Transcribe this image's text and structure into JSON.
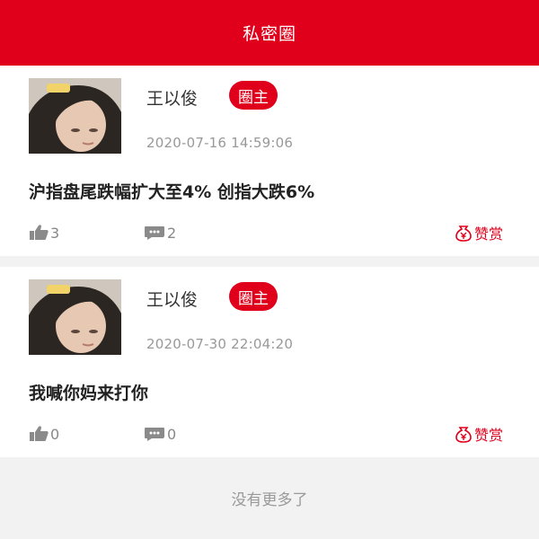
{
  "header": {
    "title": "私密圈"
  },
  "posts": [
    {
      "author": "王以俊",
      "badge": "圈主",
      "timestamp": "2020-07-16 14:59:06",
      "content": "沪指盘尾跌幅扩大至4% 创指大跌6%",
      "likes": "3",
      "comments": "2",
      "reward_label": "赞赏"
    },
    {
      "author": "王以俊",
      "badge": "圈主",
      "timestamp": "2020-07-30 22:04:20",
      "content": "我喊你妈来打你",
      "likes": "0",
      "comments": "0",
      "reward_label": "赞赏"
    }
  ],
  "footer": {
    "text": "没有更多了"
  },
  "colors": {
    "brand": "#e0001b",
    "muted": "#999999",
    "background": "#f2f2f2"
  },
  "icons": [
    "thumbs-up-icon",
    "comment-icon",
    "money-bag-icon"
  ]
}
